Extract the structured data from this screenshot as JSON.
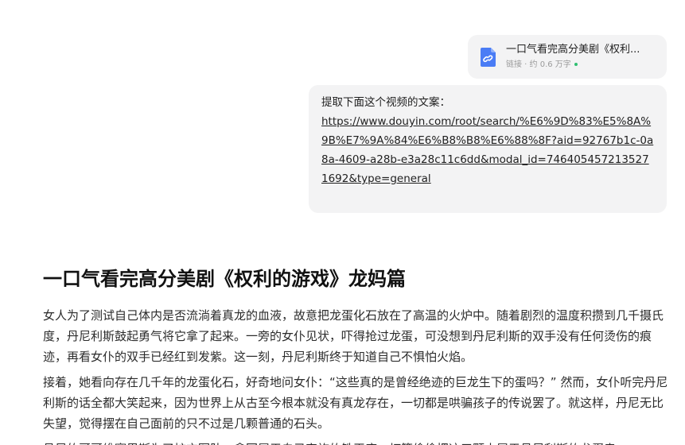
{
  "attachment": {
    "icon": "link-file-icon",
    "title": "一口气看完高分美剧《权利...",
    "meta": "链接 · 约 0.6 万字",
    "status_color": "#2fbf71"
  },
  "user_message": {
    "prompt": "提取下面这个视频的文案：",
    "link": "https://www.douyin.com/root/search/%E6%9D%83%E5%8A%9B%E7%9A%84%E6%B8%B8%E6%88%8F?aid=92767b1c-0a8a-4609-a28b-e3a28c11c6dd&modal_id=7464054572135271692&type=general"
  },
  "answer": {
    "title": "一口气看完高分美剧《权利的游戏》龙妈篇",
    "paragraphs": [
      "女人为了测试自己体内是否流淌着真龙的血液，故意把龙蛋化石放在了高温的火炉中。随着剧烈的温度积攒到几千摄氏度，丹尼利斯鼓起勇气将它拿了起来。一旁的女仆见状，吓得抢过龙蛋，可没想到丹尼利斯的双手没有任何烫伤的痕迹，再看女仆的双手已经红到发紫。这一刻，丹尼利斯终于知道自己不惧怕火焰。",
      "接着，她看向存在几千年的龙蛋化石，好奇地问女仆：“这些真的是曾经绝迹的巨龙生下的蛋吗？” 然而，女仆听完丹尼利斯的话全都大笑起来，因为世界上从古至今根本就没有真龙存在，一切都是哄骗孩子的传说罢了。就这样，丹尼无比失望，觉得摆在自己面前的只不过是几颗普通的石头。",
      "丹尼的哥哥维赛里斯为了扩充军队，拿回属于自己家族的铁王座，打算偷偷把这三颗本属于丹尼利斯的龙蛋卖"
    ]
  }
}
